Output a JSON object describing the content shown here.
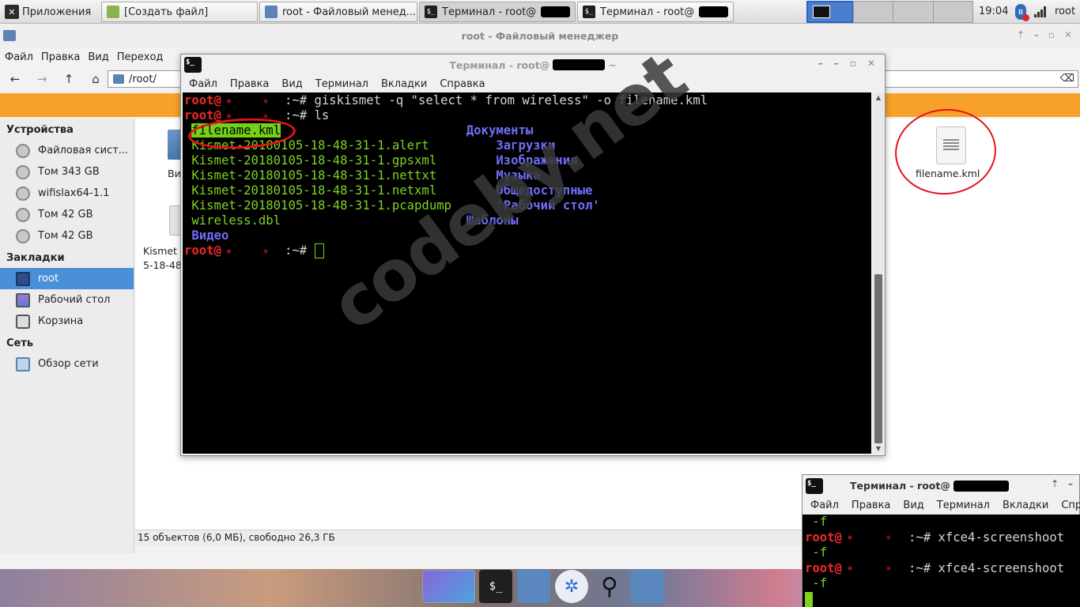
{
  "panel": {
    "apps_menu": "Приложения",
    "tasks": [
      {
        "label": "[Создать файл]"
      },
      {
        "label": "root - Файловый менед..."
      },
      {
        "label": "Терминал - root@"
      },
      {
        "label": "Терминал - root@"
      }
    ],
    "clock": "19:04",
    "user": "root"
  },
  "file_manager": {
    "title": "root - Файловый менеджер",
    "menu": [
      "Файл",
      "Правка",
      "Вид",
      "Переход"
    ],
    "path": "/root/",
    "sidebar": {
      "devices_header": "Устройства",
      "devices": [
        "Файловая сист...",
        "Том 343 GB",
        "wifislax64-1.1",
        "Том 42 GB",
        "Том 42 GB"
      ],
      "bookmarks_header": "Закладки",
      "bookmarks": [
        "root",
        "Рабочий стол",
        "Корзина"
      ],
      "network_header": "Сеть",
      "network": [
        "Обзор сети"
      ]
    },
    "content": {
      "frag_video": "Ви",
      "frag_kismet_1": "Kismet",
      "frag_kismet_2": "5-18-48",
      "file_label": "filename.kml"
    },
    "status": "15 объектов (6,0 МБ), свободно 26,3 ГБ"
  },
  "terminal": {
    "title": "Терминал - root@",
    "title_suffix": "~",
    "menu": [
      "Файл",
      "Правка",
      "Вид",
      "Терминал",
      "Вкладки",
      "Справка"
    ],
    "prompt_user": "root@",
    "prompt_path": ":~#",
    "cmd1": " giskismet -q \"select * from wireless\" -o filename.kml",
    "cmd2": " ls",
    "files": [
      "filename.kml",
      "Kismet-20180105-18-48-31-1.alert",
      "Kismet-20180105-18-48-31-1.gpsxml",
      "Kismet-20180105-18-48-31-1.nettxt",
      "Kismet-20180105-18-48-31-1.netxml",
      "Kismet-20180105-18-48-31-1.pcapdump",
      "wireless.dbl"
    ],
    "dirs_left": [
      "Видео"
    ],
    "dirs_right": [
      "Документы",
      "Загрузки",
      "Изображения",
      "Музыка",
      "Общедоступные",
      "'Рабочий стол'",
      "Шаблоны"
    ]
  },
  "terminal2": {
    "title": "Терминал - root@",
    "menu": [
      "Файл",
      "Правка",
      "Вид",
      "Терминал",
      "Вкладки",
      "Спр"
    ],
    "flag": " -f",
    "prompt_user": "root@",
    "cmd": ":~# xfce4-screenshoot"
  },
  "watermark": "codeby.net",
  "colors": {
    "accent": "#4a90d9",
    "banner": "#f7a12a",
    "annotation": "#e5121b",
    "term_green": "#7ed321",
    "term_red": "#ef2929",
    "term_blue": "#6f6ff7"
  }
}
